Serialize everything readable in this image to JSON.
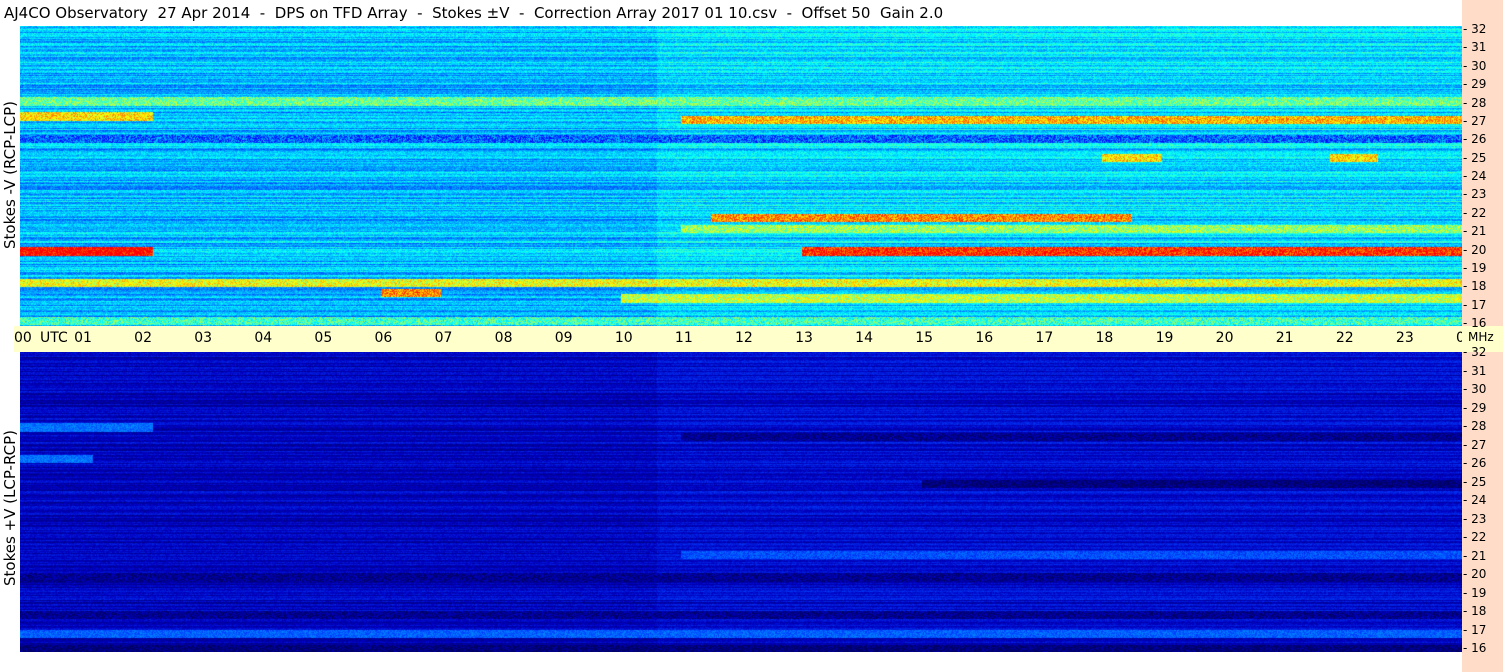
{
  "title": "AJ4CO Observatory  27 Apr 2014  -  DPS on TFD Array  -  Stokes ±V  -  Correction Array 2017 01 10.csv  -  Offset 50  Gain 2.0",
  "chart_data": [
    {
      "type": "heatmap",
      "ylabel": "Stokes -V (RCP-LCP)",
      "y_unit": "MHz",
      "y_range": [
        16,
        32
      ],
      "y_ticks": [
        "32",
        "31",
        "30",
        "29",
        "28",
        "27",
        "26",
        "25",
        "24",
        "23",
        "22",
        "21",
        "20",
        "19",
        "18",
        "17",
        "16"
      ],
      "x_range_utc_hours": [
        0,
        24
      ],
      "x_ticks": [
        "00",
        "UTC",
        "01",
        "02",
        "03",
        "04",
        "05",
        "06",
        "07",
        "08",
        "09",
        "10",
        "11",
        "12",
        "13",
        "14",
        "15",
        "16",
        "17",
        "18",
        "19",
        "20",
        "21",
        "22",
        "23",
        "00",
        "MHz"
      ],
      "base_level": 0.35,
      "colormap": [
        "#000080",
        "#0000ff",
        "#0080ff",
        "#00ffff",
        "#80ff80",
        "#ffff00",
        "#ff8000",
        "#ff0000"
      ],
      "bands": [
        {
          "mhz": 28.0,
          "hours": [
            0,
            24
          ],
          "level": 0.55
        },
        {
          "mhz": 27.2,
          "hours": [
            0,
            2.2
          ],
          "level": 0.75
        },
        {
          "mhz": 27.0,
          "hours": [
            11,
            24
          ],
          "level": 0.8
        },
        {
          "mhz": 26.0,
          "hours": [
            0,
            24
          ],
          "level": 0.25
        },
        {
          "mhz": 25.0,
          "hours": [
            18,
            19
          ],
          "level": 0.75
        },
        {
          "mhz": 25.0,
          "hours": [
            21.8,
            22.6
          ],
          "level": 0.75
        },
        {
          "mhz": 21.8,
          "hours": [
            11.5,
            18.5
          ],
          "level": 0.85
        },
        {
          "mhz": 21.2,
          "hours": [
            11,
            24
          ],
          "level": 0.6
        },
        {
          "mhz": 20.0,
          "hours": [
            0,
            2.2
          ],
          "level": 1.0
        },
        {
          "mhz": 20.0,
          "hours": [
            13,
            24
          ],
          "level": 0.95
        },
        {
          "mhz": 18.3,
          "hours": [
            0,
            24
          ],
          "level": 0.7
        },
        {
          "mhz": 17.8,
          "hours": [
            6,
            7
          ],
          "level": 0.85
        },
        {
          "mhz": 17.5,
          "hours": [
            10,
            24
          ],
          "level": 0.65
        },
        {
          "mhz": 16.3,
          "hours": [
            0,
            24
          ],
          "level": 0.5
        }
      ]
    },
    {
      "type": "heatmap",
      "ylabel": "Stokes +V (LCP-RCP)",
      "y_unit": "MHz",
      "y_range": [
        16,
        32
      ],
      "y_ticks": [
        "32",
        "31",
        "30",
        "29",
        "28",
        "27",
        "26",
        "25",
        "24",
        "23",
        "22",
        "21",
        "20",
        "19",
        "18",
        "17",
        "16"
      ],
      "x_range_utc_hours": [
        0,
        24
      ],
      "base_level": 0.2,
      "colormap": [
        "#000060",
        "#0000c0",
        "#0040ff",
        "#0080ff",
        "#00c0ff",
        "#40ffc0"
      ],
      "bands": [
        {
          "mhz": 28.0,
          "hours": [
            0,
            2.2
          ],
          "level": 0.55
        },
        {
          "mhz": 27.5,
          "hours": [
            11,
            24
          ],
          "level": 0.1
        },
        {
          "mhz": 26.3,
          "hours": [
            0,
            1.2
          ],
          "level": 0.55
        },
        {
          "mhz": 25.0,
          "hours": [
            15,
            24
          ],
          "level": 0.05
        },
        {
          "mhz": 21.2,
          "hours": [
            11,
            24
          ],
          "level": 0.45
        },
        {
          "mhz": 20.0,
          "hours": [
            0,
            24
          ],
          "level": 0.1
        },
        {
          "mhz": 18.0,
          "hours": [
            0,
            24
          ],
          "level": 0.1
        },
        {
          "mhz": 17.0,
          "hours": [
            0,
            24
          ],
          "level": 0.5
        },
        {
          "mhz": 16.2,
          "hours": [
            0,
            24
          ],
          "level": 0.05
        }
      ]
    }
  ]
}
